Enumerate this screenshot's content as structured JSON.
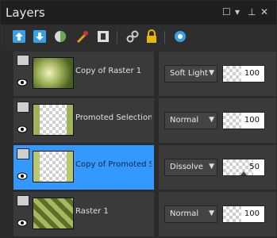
{
  "panel": {
    "title": "Layers"
  },
  "toolbar": {
    "tools": [
      {
        "name": "new-layer-up-icon"
      },
      {
        "name": "new-layer-down-icon"
      },
      {
        "name": "adjustment-layer-icon"
      },
      {
        "name": "brush-icon"
      },
      {
        "name": "mask-icon"
      },
      {
        "name": "link-icon"
      },
      {
        "name": "lock-icon"
      },
      {
        "name": "properties-icon"
      }
    ]
  },
  "layers": [
    {
      "name": "Copy of Raster 1",
      "blend": "Soft Light",
      "opacity": "100",
      "opacity_value": 100,
      "selected": false
    },
    {
      "name": "Promoted Selection",
      "blend": "Normal",
      "opacity": "100",
      "opacity_value": 100,
      "selected": false
    },
    {
      "name": "Copy of Promoted Selection",
      "blend": "Dissolve",
      "opacity": "50",
      "opacity_value": 50,
      "selected": true
    },
    {
      "name": "Raster 1",
      "blend": "Normal",
      "opacity": "100",
      "opacity_value": 100,
      "selected": false
    }
  ],
  "colors": {
    "selected": "#3399ff",
    "panel": "#2e2e2e",
    "row": "#3a3a3a"
  }
}
